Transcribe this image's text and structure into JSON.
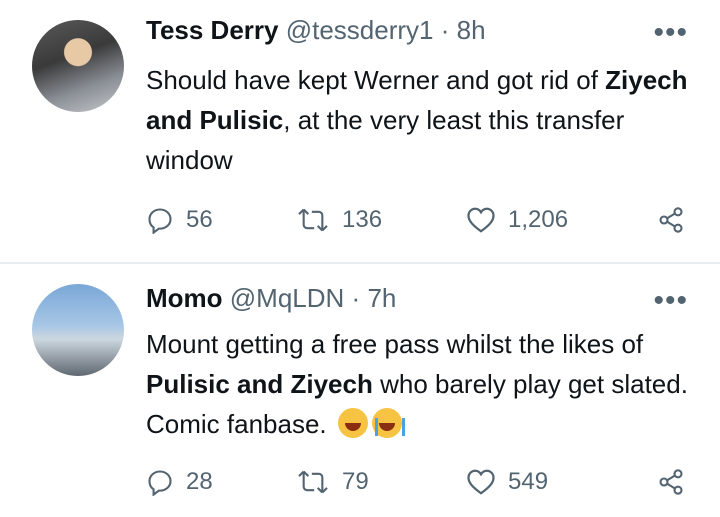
{
  "tweets": [
    {
      "name": "Tess Derry",
      "handle": "@tessderry1",
      "sep": "·",
      "time": "8h",
      "body_parts": [
        "Should have kept Werner and got rid of ",
        "Ziyech and Pulisic",
        ", at the very least this transfer window"
      ],
      "replies": "56",
      "retweets": "136",
      "likes": "1,206"
    },
    {
      "name": "Momo",
      "handle": "@MqLDN",
      "sep": "·",
      "time": "7h",
      "body_parts": [
        "Mount getting a free pass whilst the likes of ",
        "Pulisic and Ziyech",
        " who barely play get slated. Comic fanbase. "
      ],
      "emojis": [
        "face-with-tears-of-joy",
        "loudly-crying-face"
      ],
      "replies": "28",
      "retweets": "79",
      "likes": "549"
    }
  ],
  "more_label": "•••",
  "colors": {
    "text": "#0f1419",
    "secondary": "#536471",
    "divider": "#e6ecf0"
  }
}
